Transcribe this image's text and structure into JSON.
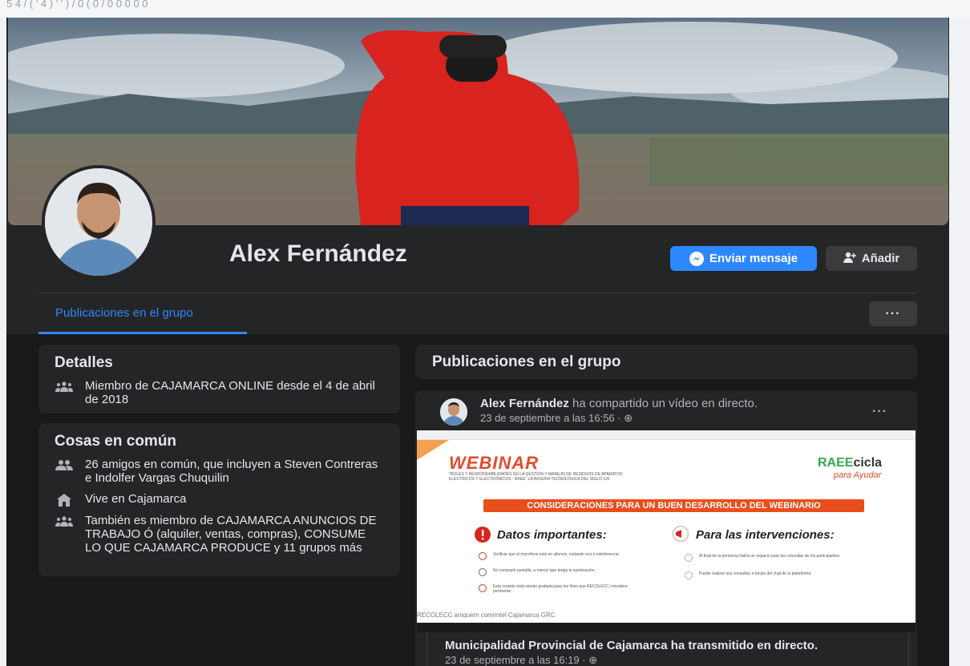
{
  "top_strip": {
    "text": "5 4 / ( ' 4 ) ' ' ) / 0 ( 0 / 0 0 0 0 0"
  },
  "profile": {
    "name": "Alex Fernández",
    "message_button": "Enviar mensaje",
    "add_button": "Añadir",
    "more_button": "···",
    "tabs": [
      {
        "label": "Publicaciones en el grupo",
        "active": true
      }
    ]
  },
  "colors": {
    "accent": "#2d88ff",
    "card": "#242526",
    "page": "#18191a",
    "text": "#e4e6eb",
    "muted": "#b0b3b8"
  },
  "details": {
    "title": "Detalles",
    "member_since": "Miembro de CAJAMARCA ONLINE desde el 4 de abril de 2018",
    "icon": "group-icon"
  },
  "common": {
    "title": "Cosas en común",
    "items": [
      {
        "icon": "friends-icon",
        "text": "26 amigos en común, que incluyen a Steven Contreras e Indolfer Vargas Chuquilin"
      },
      {
        "icon": "home-icon",
        "text": "Vive en Cajamarca"
      },
      {
        "icon": "group-icon",
        "text": "También es miembro de CAJAMARCA ANUNCIOS DE TRABAJO Ó (alquiler, ventas, compras), CONSUME LO QUE CAJAMARCA PRODUCE y 11 grupos más"
      }
    ]
  },
  "posts": {
    "title": "Publicaciones en el grupo",
    "post": {
      "author": "Alex Fernández",
      "action": " ha compartido un vídeo en directo.",
      "time": "23 de septiembre a las 16:56 · ⊕",
      "menu": "···",
      "video": {
        "title": "WEBINAR",
        "subtitle": "\"ROLES Y RESPONSABILIDADES EN LA GESTIÓN Y MANEJO DE RESIDUOS DE APARATOS ELÉCTRICOS Y ELECTRÓNICOS - RAEE\" LA BASURA TECNOLÓGICA DEL SIGLO XXI",
        "brand_1": "RAEE",
        "brand_2": "cicla",
        "brand_sub": "para Ayudar",
        "banner": "CONSIDERACIONES PARA UN BUEN DESARROLLO DEL WEBINARIO",
        "left_title": "Datos importantes:",
        "right_title": "Para las intervenciones:",
        "left_items": [
          "Verificar que el micrófono esté en silencio, evitando eco e interferencia.",
          "No compartir pantalla, a menos que tenga la autorización.",
          "Está reunión está siendo grabada para los fines que RECOLECC considere pertinente."
        ],
        "right_items": [
          "Al final de la ponencia habrá un espacio para las consultas de los participantes.",
          "Puede realizar sus consultas a través del chat de la plataforma."
        ],
        "logos": "RECOLECC   aniquem   comimtel   Cajamarca   GRC"
      },
      "shared": {
        "title": "Municipalidad Provincial de Cajamarca ha transmitido en directo.",
        "time": "23 de septiembre a las 16:19 · ⊕"
      }
    }
  }
}
